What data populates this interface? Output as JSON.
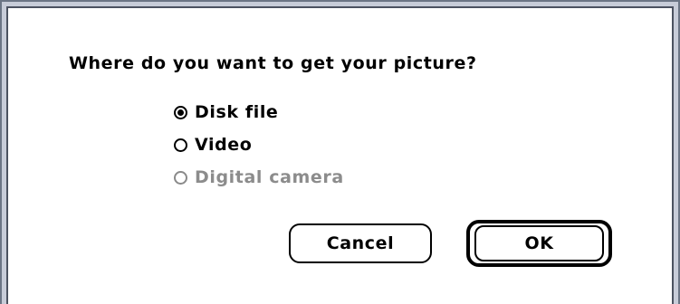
{
  "dialog": {
    "prompt": "Where do you want to get your picture?",
    "options": [
      {
        "label": "Disk file",
        "checked": true,
        "enabled": true
      },
      {
        "label": "Video",
        "checked": false,
        "enabled": true
      },
      {
        "label": "Digital camera",
        "checked": false,
        "enabled": false
      }
    ],
    "buttons": {
      "cancel_label": "Cancel",
      "ok_label": "OK",
      "default": "OK"
    }
  },
  "colors": {
    "frame_outer": "#6b7585",
    "frame_band": "#c7ccd8",
    "frame_inner": "#4b5260",
    "disabled_text": "#8c8c8c",
    "text": "#000000",
    "background": "#ffffff"
  },
  "icons": {
    "radio_selected": "radio-selected-icon",
    "radio_unselected": "radio-unselected-icon"
  }
}
